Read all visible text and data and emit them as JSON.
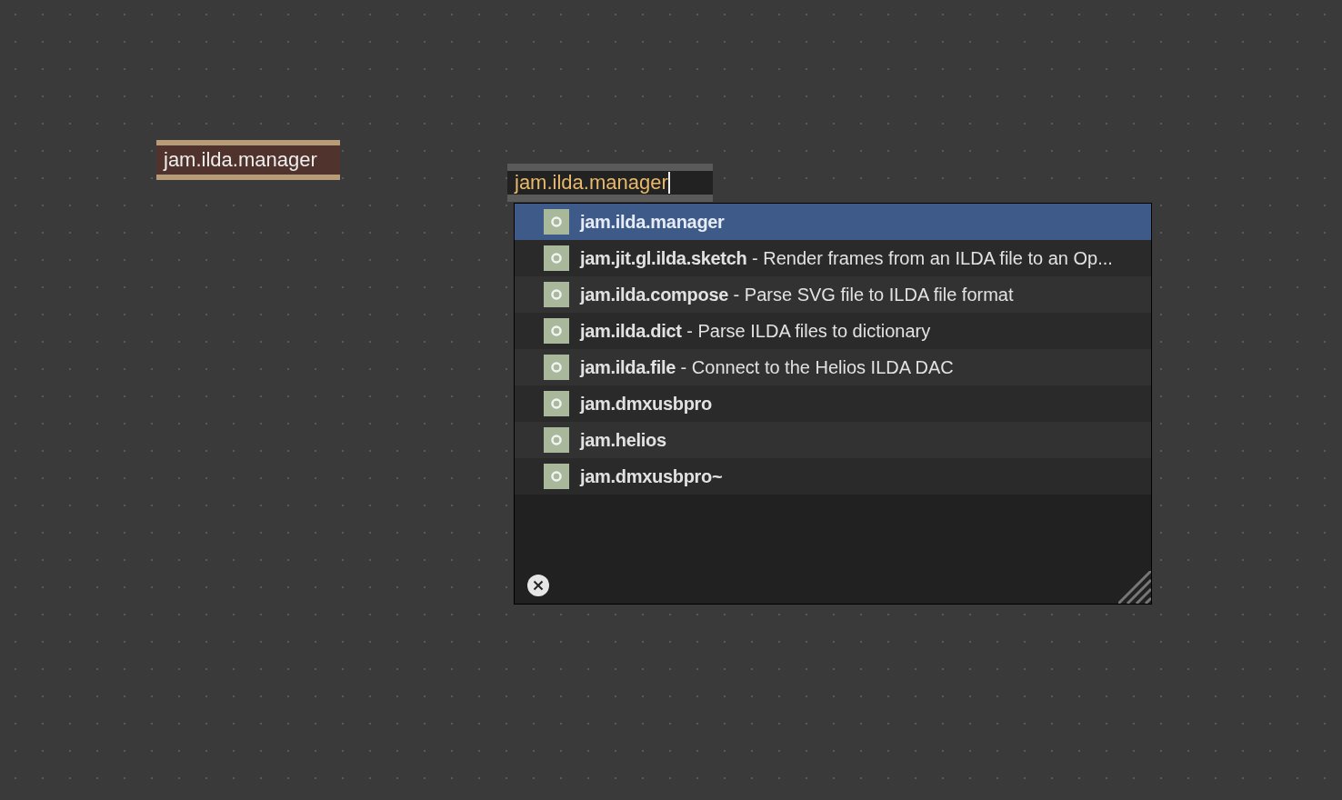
{
  "patcher": {
    "objects": [
      {
        "text": "jam.ilda.manager"
      }
    ],
    "editing_object": {
      "value": "jam.ilda.manager"
    },
    "autocomplete": {
      "items": [
        {
          "name": "jam.ilda.manager",
          "selected": true
        },
        {
          "name": "jam.jit.gl.ilda.sketch",
          "description": "Render frames from an ILDA file to an Op...",
          "selected": false
        },
        {
          "name": "jam.ilda.compose",
          "description": "Parse SVG file to ILDA file format",
          "selected": false
        },
        {
          "name": "jam.ilda.dict",
          "description": "Parse ILDA files to dictionary",
          "selected": false
        },
        {
          "name": "jam.ilda.file",
          "description": "Connect to the Helios ILDA DAC",
          "selected": false
        },
        {
          "name": "jam.dmxusbpro",
          "selected": false
        },
        {
          "name": "jam.helios",
          "selected": false
        },
        {
          "name": "jam.dmxusbpro~",
          "selected": false
        }
      ],
      "separator": "-"
    }
  }
}
